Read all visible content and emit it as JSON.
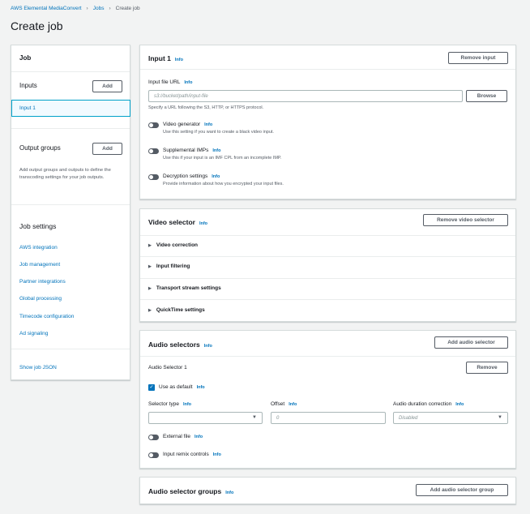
{
  "breadcrumb": {
    "service": "AWS Elemental MediaConvert",
    "jobs": "Jobs",
    "current": "Create job",
    "sep": "›"
  },
  "page_title": "Create job",
  "sidebar": {
    "title": "Job",
    "inputs_label": "Inputs",
    "add_label": "Add",
    "input_item": "Input 1",
    "output_groups_label": "Output groups",
    "output_groups_desc": "Add output groups and outputs to define the transcoding settings for your job outputs.",
    "job_settings_label": "Job settings",
    "settings_links": [
      "AWS integration",
      "Job management",
      "Partner integrations",
      "Global processing",
      "Timecode configuration",
      "Ad signaling"
    ],
    "show_json": "Show job JSON"
  },
  "input_panel": {
    "title": "Input 1",
    "info": "Info",
    "remove_label": "Remove input",
    "url_label": "Input file URL",
    "url_placeholder": "s3://bucket/path/input-file",
    "browse_label": "Browse",
    "url_hint": "Specify a URL following the S3, HTTP, or HTTPS protocol.",
    "toggles": [
      {
        "label": "Video generator",
        "desc": "Use this setting if you want to create a black video input."
      },
      {
        "label": "Supplemental IMPs",
        "desc": "Use this if your input is an IMF CPL from an incomplete IMP."
      },
      {
        "label": "Decryption settings",
        "desc": "Provide information about how you encrypted your input files."
      }
    ]
  },
  "video_selector": {
    "title": "Video selector",
    "info": "Info",
    "remove_label": "Remove video selector",
    "sections": [
      "Video correction",
      "Input filtering",
      "Transport stream settings",
      "QuickTime settings"
    ]
  },
  "audio_selectors": {
    "title": "Audio selectors",
    "info": "Info",
    "add_label": "Add audio selector",
    "selector_name": "Audio Selector 1",
    "remove_label": "Remove",
    "use_default": "Use as default",
    "selector_type_label": "Selector type",
    "offset_label": "Offset",
    "offset_placeholder": "0",
    "duration_label": "Audio duration correction",
    "duration_value": "Disabled",
    "external_file": "External file",
    "remix_controls": "Input remix controls"
  },
  "audio_selector_groups": {
    "title": "Audio selector groups",
    "info": "Info",
    "add_label": "Add audio selector group"
  },
  "colors": {
    "link": "#0073bb",
    "accent": "#0073bb",
    "toggle_off": "#545b64",
    "background": "#f2f3f3"
  }
}
